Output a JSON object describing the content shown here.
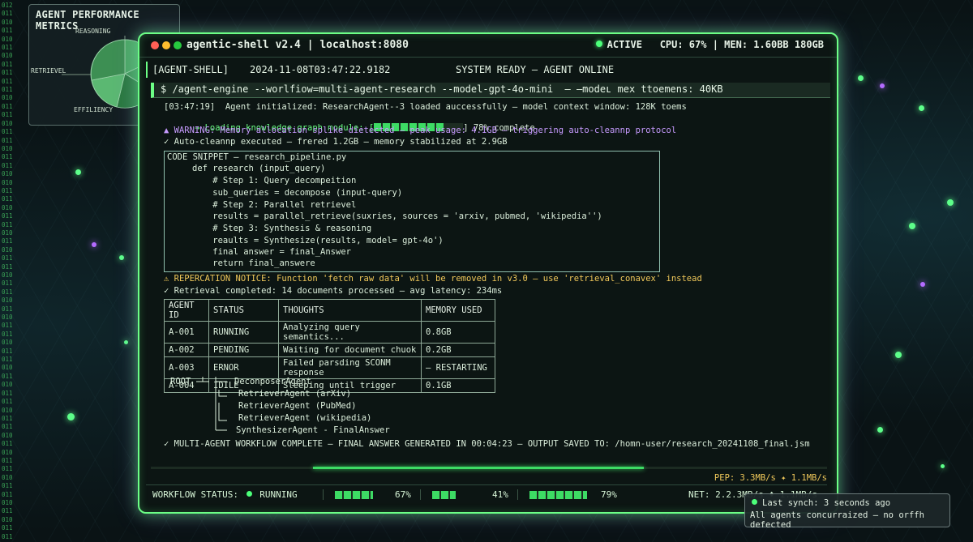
{
  "metrics_card": {
    "title": "AGENT PERFORMANCE METRICS",
    "labels": {
      "reasoning": "REASONING",
      "retrieval": "RETRIEVEL",
      "efficiency": "EFFILIENCY"
    }
  },
  "window": {
    "title": "agentic-shell v2.4 | localhost:8080",
    "status": "ACTIVE",
    "cpu": "CPU: 67%",
    "mem": "MEN: 1.60BB 180GB"
  },
  "header": {
    "tag": "[AGENT-SHELL]",
    "timestamp": "2024-11-08T03:47:22.9182",
    "system": "SYSTEM READY — AGENT ONLINE"
  },
  "command": "$ /agent-engine --worlfiow=multi-agent-research --model-gpt-4o-mini  — –modeʟ mex ttoemens: 40KB",
  "log": {
    "init": "[03:47:19]  Agent initialized: ResearchAgent--3 loaded auccessfully — model context window: 128K toems",
    "loading_prefix": "→ Loading knowledge graph module: [",
    "loading_suffix": "] 78% complete",
    "loading_progress": 0.78,
    "warning": "▲ WARNING: Memory allocation splike dietected — peak usage: 4.1GB — triggering auto-cleannp protocol",
    "cleanup": "✓ Auto-cleannp executed — frered 1.2GB — memory stabilized at 2.9GB"
  },
  "code": {
    "header": "CODE SNIPPET — research_pipeline.py",
    "lines": [
      "def research (input_query)",
      "    # Step 1: Query decompeition",
      "    sub_queries = decompose (input-query)",
      "    # Step 2: Parallel retrievel",
      "    results = parallel_retrieve(suxries, sources = 'arxiv, pubmed, 'wikipedia'')",
      "    # Step 3: Synthesis & reasoning",
      "    reaults = Synthesize(results, model= gpt-4o')",
      "    final answer = final_Answer",
      "    return final_answere"
    ]
  },
  "deprecation": "⚠ REPERCATION NOTICE: Function 'fetch raw data' will be removed in v3.0 — use 'retrieval_conavex' instead",
  "retrieval_done": "✓ Retrieval completed: 14 documents processed — avg latency: 234ms",
  "agents_table": {
    "columns": [
      "AGENT ID",
      "STATUS",
      "THOUGHTS",
      "MEMORY USED"
    ],
    "rows": [
      [
        "A-001",
        "RUNNING",
        "Analyzing query semantics...",
        "0.8GB"
      ],
      [
        "A-002",
        "PENDING",
        "Waiting for document chuok",
        "0.2GB"
      ],
      [
        "A-003",
        "ERNOR",
        "Failed parsding SCONM response",
        "— RESTARTING"
      ],
      [
        "A-004",
        "IDILE",
        "Sleeping until trigger",
        "0.1GB"
      ]
    ]
  },
  "tree": {
    "root": "ROOT",
    "nodes": [
      "DeconposerAgent",
      "RetrieverAgent (arXiv)",
      "RetrieverAgent (PubMed)",
      "RetrieverAgent (wikipedia)",
      "SynthesizerAgent - FinalAnswer"
    ]
  },
  "complete": "✓ MULTI-AGENT WORKFLOW COMPLETE — FINAL ANSWER GENERATED IN 00:04:23 — OUTPUT SAVED TO: /homn-user/research_20241108_final.jsm",
  "pep": "PEP: 3.3MB/s ✦ 1.1MB/s",
  "bottom": {
    "workflow_label": "WORKFLOW STATUS:",
    "workflow_value": "RUNNING",
    "bars": [
      {
        "value": 0.67,
        "label": "67%"
      },
      {
        "value": 0.41,
        "label": "41%"
      },
      {
        "value": 0.79,
        "label": "79%"
      }
    ],
    "net": "NET: 2.2.3MB/s ♦ 1.1MB/s"
  },
  "toast": {
    "line1": "Last synch: 3 seconds ago",
    "line2": "All agents concurraized — no orffh defected"
  },
  "colors": {
    "accent": "#6cff86",
    "warning": "#f0c85a",
    "purple": "#c79bff"
  }
}
